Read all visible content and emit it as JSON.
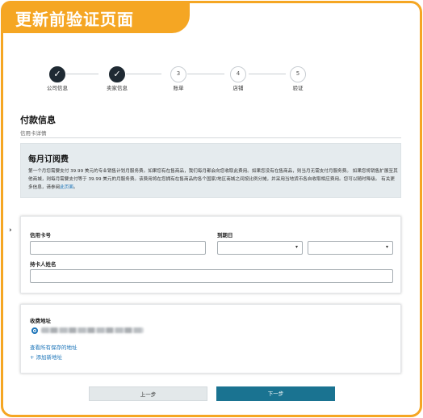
{
  "banner": {
    "title": "更新前验证页面"
  },
  "stepper": {
    "steps": [
      {
        "number": "1",
        "label": "公司信息",
        "done": true
      },
      {
        "number": "2",
        "label": "卖家信息",
        "done": true
      },
      {
        "number": "3",
        "label": "账单",
        "done": false
      },
      {
        "number": "4",
        "label": "店铺",
        "done": false
      },
      {
        "number": "5",
        "label": "验证",
        "done": false
      }
    ],
    "done_glyph": "✓"
  },
  "payment": {
    "title": "付款信息",
    "subtitle": "信用卡详情"
  },
  "monthly_fee": {
    "title": "每月订阅费",
    "text": "第一个月您需要支付 39.99 美元的专业销售计划月服务费。如果您有在售商品，我们每月都会向您收取此费用。如果您没有在售商品，则当月无需支付月服务费。 如果您将销售扩展至其他商城，则每月需要支付等于 39.99 美元的月服务费。该费用将在您拥有在售商品的各个国家/地区商城之间按比例分摊，并采用当地货币各自收取相应费用。您可以随时降级。 有关更多信息，请参阅",
    "link": "此页面",
    "end": "。"
  },
  "card_form": {
    "card_number_label": "信用卡号",
    "card_number_value": "",
    "expiry_label": "到期日",
    "month_value": "",
    "year_value": "",
    "holder_label": "持卡人姓名",
    "holder_value": ""
  },
  "billing": {
    "title": "收费地址",
    "view_all": "查看所有保存的地址",
    "add_new": "+ 添加新地址"
  },
  "buttons": {
    "back": "上一步",
    "next": "下一步"
  },
  "icons": {
    "side_chevron": "›",
    "select_arrow": "▾"
  },
  "colors": {
    "accent": "#f5a623",
    "primary": "#1a7391",
    "link": "#1a73b8",
    "step_done": "#1f2a33"
  }
}
